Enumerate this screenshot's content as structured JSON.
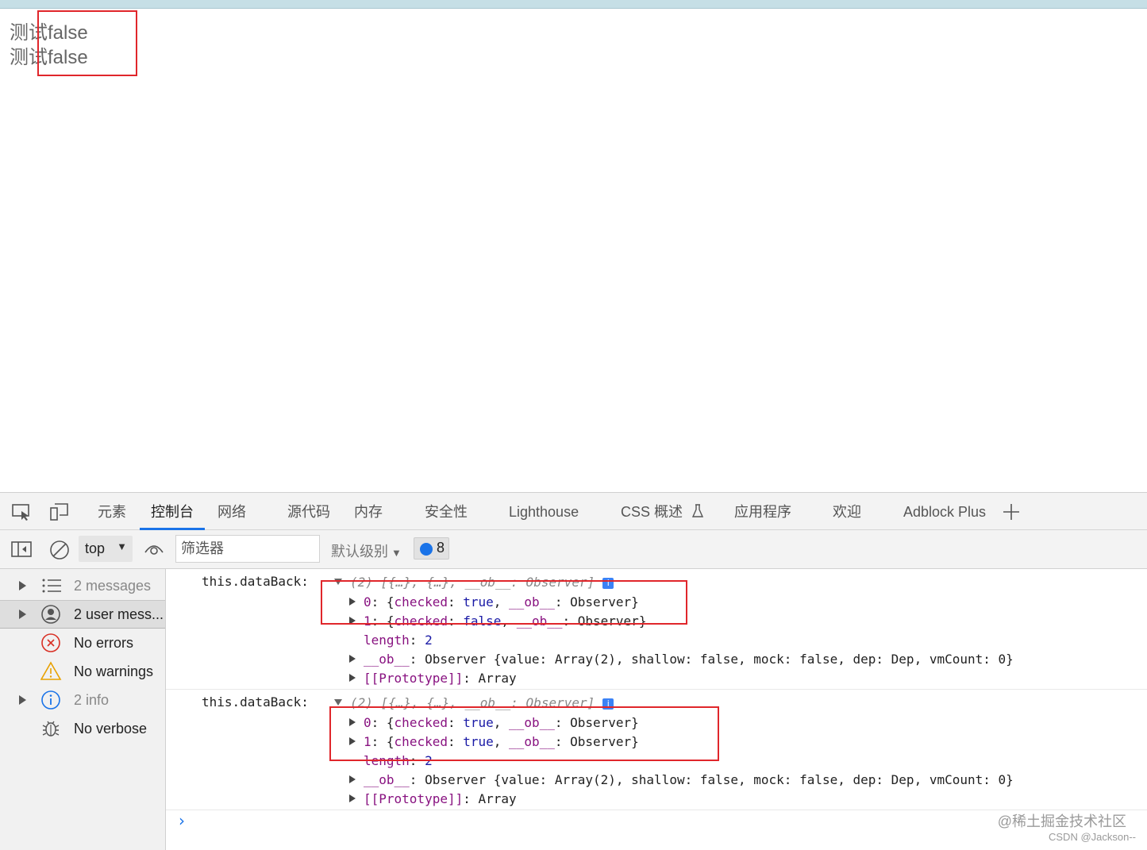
{
  "page": {
    "lines": [
      "测试false",
      "测试false"
    ]
  },
  "devtools": {
    "tabs": [
      "元素",
      "控制台",
      "网络",
      "源代码",
      "内存",
      "安全性",
      "Lighthouse",
      "CSS 概述",
      "应用程序",
      "欢迎",
      "Adblock Plus"
    ],
    "active_tab": "控制台",
    "toolbar": {
      "context": "top",
      "filter_placeholder": "筛选器",
      "levels": "默认级别",
      "issues_count": "8"
    },
    "sidebar": [
      {
        "label": "2 messages",
        "icon": "list-icon",
        "expandable": true,
        "dim": true
      },
      {
        "label": "2 user mess...",
        "icon": "user-icon",
        "expandable": true,
        "selected": true
      },
      {
        "label": "No errors",
        "icon": "error-icon"
      },
      {
        "label": "No warnings",
        "icon": "warning-icon"
      },
      {
        "label": "2 info",
        "icon": "info-icon",
        "expandable": true,
        "dim": true
      },
      {
        "label": "No verbose",
        "icon": "bug-icon"
      }
    ],
    "messages": [
      {
        "label": "this.dataBack:",
        "summary": "(2) [{…}, {…}, __ob__: Observer]",
        "item0": {
          "key": "0",
          "checked": "true",
          "ob": "Observer"
        },
        "item1": {
          "key": "1",
          "checked": "false",
          "ob": "Observer"
        },
        "length": "2",
        "observer_line": "Observer {value: Array(2), shallow: false, mock: false, dep: Dep, vmCount: 0}",
        "prototype": "Array"
      },
      {
        "label": "this.dataBack:",
        "summary": "(2) [{…}, {…}, __ob__: Observer]",
        "item0": {
          "key": "0",
          "checked": "true",
          "ob": "Observer"
        },
        "item1": {
          "key": "1",
          "checked": "true",
          "ob": "Observer"
        },
        "length": "2",
        "observer_line": "Observer {value: Array(2), shallow: false, mock: false, dep: Dep, vmCount: 0}",
        "prototype": "Array"
      }
    ]
  },
  "watermark": {
    "line1": "@稀土掘金技术社区",
    "line2": "CSDN @Jackson--"
  },
  "colors": {
    "accent": "#1a73e8",
    "highlight_box": "#e0262b"
  }
}
